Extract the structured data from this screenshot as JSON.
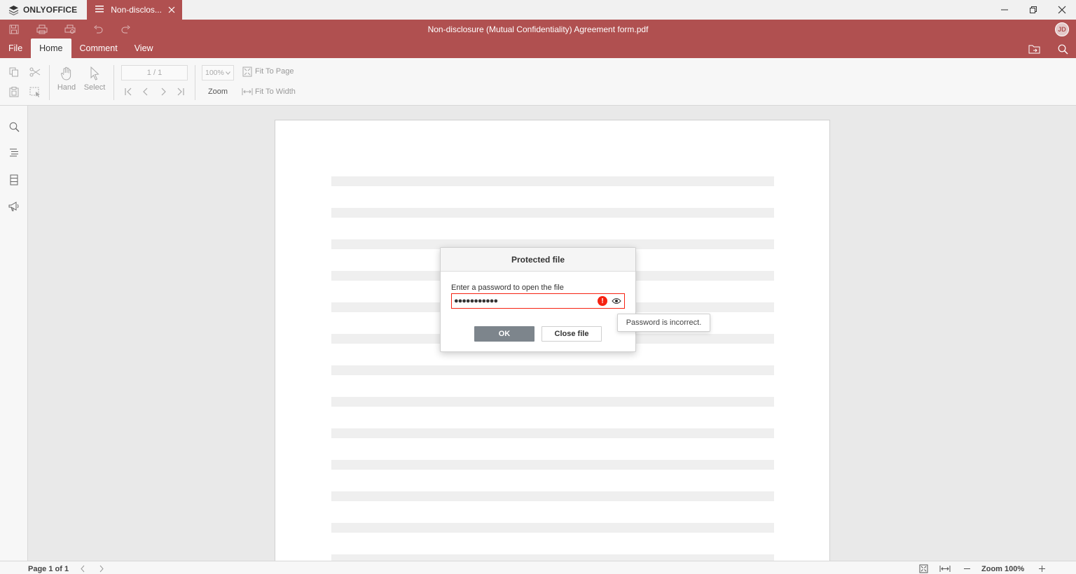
{
  "app": {
    "brand": "ONLYOFFICE",
    "tab_title": "Non-disclos...",
    "doc_title": "Non-disclosure (Mutual Confidentiality) Agreement form.pdf",
    "user_initials": "JD",
    "accent_color": "#b05050"
  },
  "menu": {
    "tabs": [
      {
        "label": "File"
      },
      {
        "label": "Home"
      },
      {
        "label": "Comment"
      },
      {
        "label": "View"
      }
    ],
    "active": "Home"
  },
  "toolbar": {
    "hand_label": "Hand",
    "select_label": "Select",
    "page_value": "1 / 1",
    "zoom_value": "100%",
    "zoom_label": "Zoom",
    "fit_page_label": "Fit To Page",
    "fit_width_label": "Fit To Width"
  },
  "dialog": {
    "title": "Protected file",
    "prompt": "Enter a password to open the file",
    "password_masked": "●●●●●●●●●●●",
    "ok_label": "OK",
    "close_label": "Close file",
    "error_tooltip": "Password is incorrect.",
    "error_color": "#f62211"
  },
  "status": {
    "page": "Page 1 of 1",
    "zoom": "Zoom 100%"
  }
}
